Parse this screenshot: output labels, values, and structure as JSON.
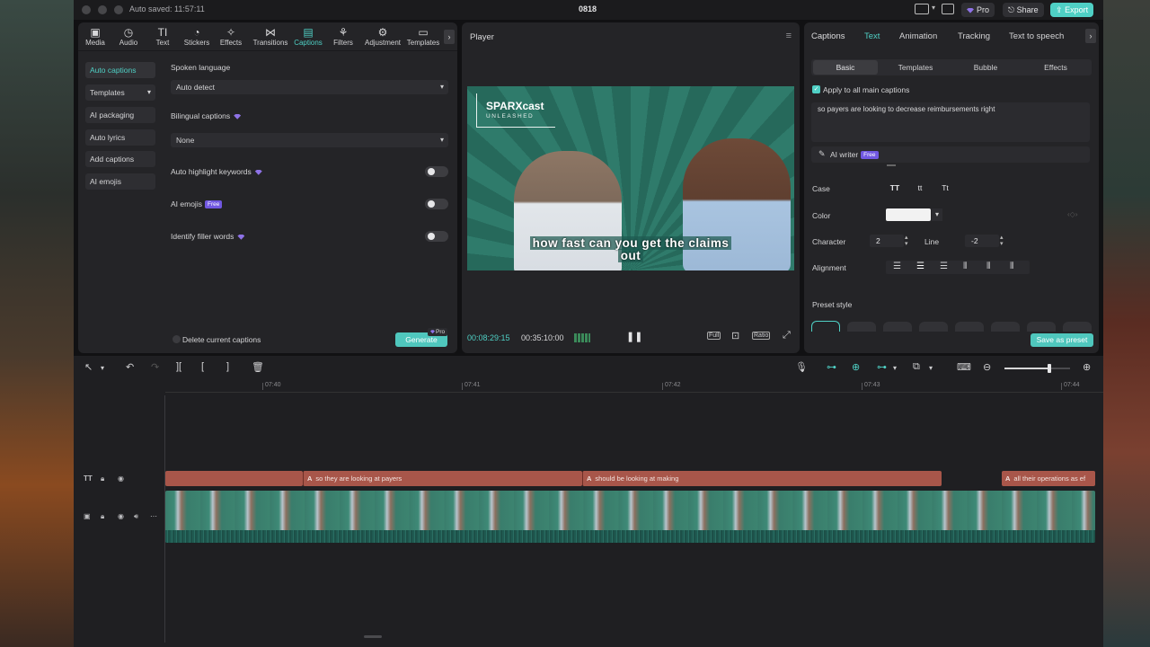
{
  "titlebar": {
    "autosave": "Auto saved: 11:57:11",
    "project": "0818",
    "pro_label": "Pro",
    "share_label": "Share",
    "export_label": "Export"
  },
  "toolbar": {
    "tools": [
      {
        "label": "Media",
        "icon": "media-icon"
      },
      {
        "label": "Audio",
        "icon": "audio-icon"
      },
      {
        "label": "Text",
        "icon": "text-icon"
      },
      {
        "label": "Stickers",
        "icon": "stickers-icon"
      },
      {
        "label": "Effects",
        "icon": "effects-icon"
      },
      {
        "label": "Transitions",
        "icon": "transitions-icon"
      },
      {
        "label": "Captions",
        "icon": "captions-icon"
      },
      {
        "label": "Filters",
        "icon": "filters-icon"
      },
      {
        "label": "Adjustment",
        "icon": "adjustment-icon"
      },
      {
        "label": "Templates",
        "icon": "templates-icon"
      }
    ],
    "active": "Captions"
  },
  "sidebar": {
    "items": [
      {
        "label": "Auto captions"
      },
      {
        "label": "Templates"
      },
      {
        "label": "AI packaging"
      },
      {
        "label": "Auto lyrics"
      },
      {
        "label": "Add captions"
      },
      {
        "label": "AI emojis"
      }
    ]
  },
  "captions_panel": {
    "spoken_language_label": "Spoken language",
    "spoken_language_value": "Auto detect",
    "bilingual_label": "Bilingual captions",
    "bilingual_value": "None",
    "auto_highlight_label": "Auto highlight keywords",
    "ai_emojis_label": "AI emojis",
    "free_badge": "Free",
    "filler_label": "Identify filler words",
    "delete_label": "Delete current captions",
    "generate_label": "Generate",
    "pro_badge": "Pro"
  },
  "player": {
    "title": "Player",
    "logo_line1": "SPARXcast",
    "logo_line2": "UNLEASHED",
    "caption_line1": "how fast can you get the claims",
    "caption_line2": "out",
    "current_time": "00:08:29:15",
    "total_time": "00:35:10:00",
    "full_label": "Full",
    "ratio_label": "Ratio"
  },
  "inspector": {
    "tabs": [
      "Captions",
      "Text",
      "Animation",
      "Tracking",
      "Text to speech"
    ],
    "active_tab": "Text",
    "subtabs": [
      "Basic",
      "Templates",
      "Bubble",
      "Effects"
    ],
    "active_subtab": "Basic",
    "apply_all_label": "Apply to all main captions",
    "caption_text": "so payers are looking to decrease reimbursements right",
    "ai_writer_label": "AI writer",
    "free_badge": "Free",
    "case_label": "Case",
    "case_options": [
      "TT",
      "tt",
      "Tt"
    ],
    "color_label": "Color",
    "color_value": "#ffffff",
    "character_label": "Character",
    "character_value": "2",
    "line_label": "Line",
    "line_value": "-2",
    "alignment_label": "Alignment",
    "preset_label": "Preset style",
    "save_preset_label": "Save as preset"
  },
  "timeline": {
    "ticks": [
      "07:40",
      "07:41",
      "07:42",
      "07:43",
      "07:44"
    ],
    "caption_segments": [
      {
        "tag": "A",
        "text": "so they are looking at payers"
      },
      {
        "tag": "A",
        "text": "should be looking at making"
      },
      {
        "tag": "A",
        "text": "all their operations as ef"
      }
    ],
    "text_track_icon": "TT"
  },
  "colors": {
    "accent": "#4fd0c5",
    "caption_track": "#a8564a",
    "panel": "#242427",
    "pro": "#7158e2"
  }
}
